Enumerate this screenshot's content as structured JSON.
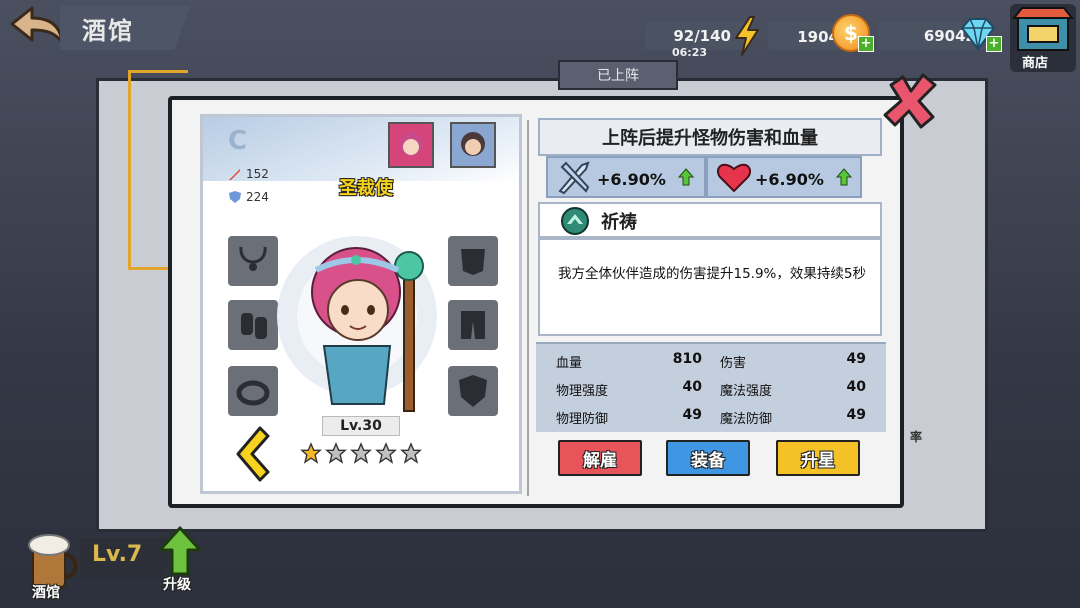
{
  "header": {
    "title": "酒馆",
    "energy": "92/140",
    "energy_timer": "06:23",
    "gold": "1904万",
    "gems": "69042",
    "shop_label": "商店"
  },
  "background": {
    "tab_label": "已上阵",
    "rate_label": "率"
  },
  "hero": {
    "rank": "C",
    "attack": "152",
    "defense": "224",
    "name": "圣裁使",
    "level": "Lv.30",
    "stars_total": 5,
    "stars_filled": 1
  },
  "info": {
    "title": "上阵后提升怪物伤害和血量",
    "buff_damage": "+6.90%",
    "buff_hp": "+6.90%",
    "skill_name": "祈祷",
    "skill_desc": "我方全体伙伴造成的伤害提升15.9%，效果持续5秒"
  },
  "attributes": [
    {
      "label": "血量",
      "value": "810"
    },
    {
      "label": "伤害",
      "value": "49"
    },
    {
      "label": "物理强度",
      "value": "40"
    },
    {
      "label": "魔法强度",
      "value": "40"
    },
    {
      "label": "物理防御",
      "value": "49"
    },
    {
      "label": "魔法防御",
      "value": "49"
    }
  ],
  "buttons": {
    "fire": "解雇",
    "equip": "装备",
    "upgrade_star": "升星"
  },
  "bottom": {
    "tavern_label": "酒馆",
    "level": "Lv.7",
    "upgrade_label": "升级"
  },
  "colors": {
    "fire_button": "#e7545a",
    "equip_button": "#3f97e4",
    "star_button": "#f4c127",
    "hero_name": "#f6d21c"
  }
}
